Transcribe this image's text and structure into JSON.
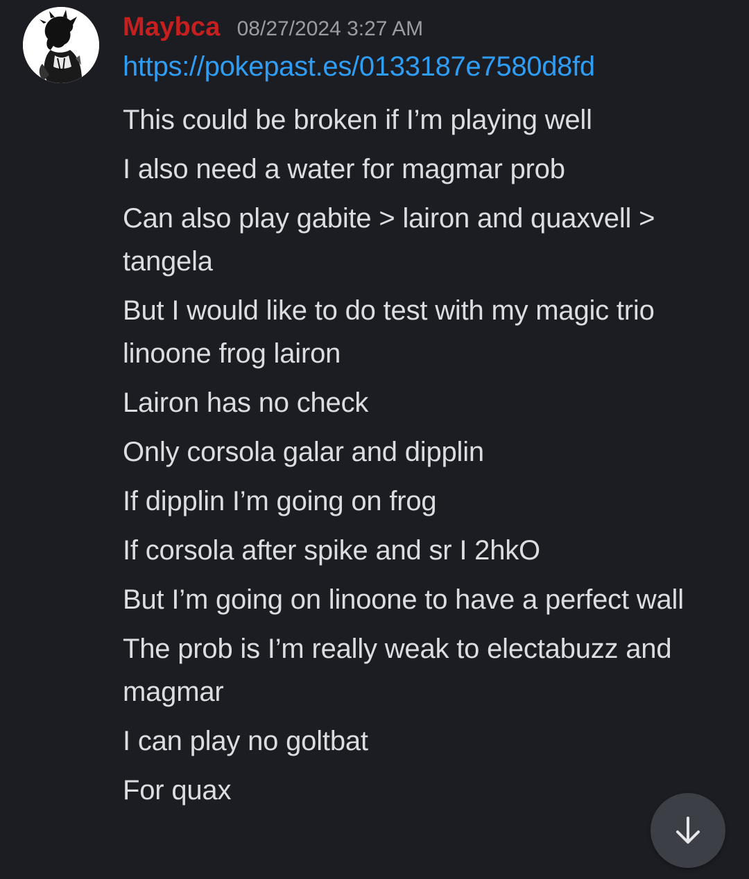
{
  "message": {
    "author": {
      "username": "Maybca",
      "name_color": "#c5201f"
    },
    "timestamp": "08/27/2024 3:27 AM",
    "link": "https://pokepast.es/0133187e7580d8fd",
    "lines": [
      "This could be broken if I’m playing well",
      "I also need a water for magmar prob",
      "Can also play gabite > lairon and quaxvell > tangela",
      "But I would like to do test with my magic trio linoone frog lairon",
      "Lairon has no check",
      "Only corsola galar and dipplin",
      "If dipplin I’m going on frog",
      "If corsola after spike and sr I 2hkO",
      "But I’m going on linoone to have a perfect wall",
      "The prob is I’m really weak to electabuzz and magmar",
      "I can play no goltbat",
      "For quax"
    ]
  },
  "ui": {
    "scroll_button_icon": "arrow-down-icon",
    "link_color": "#2f9df4",
    "background_color": "#1c1d22"
  }
}
